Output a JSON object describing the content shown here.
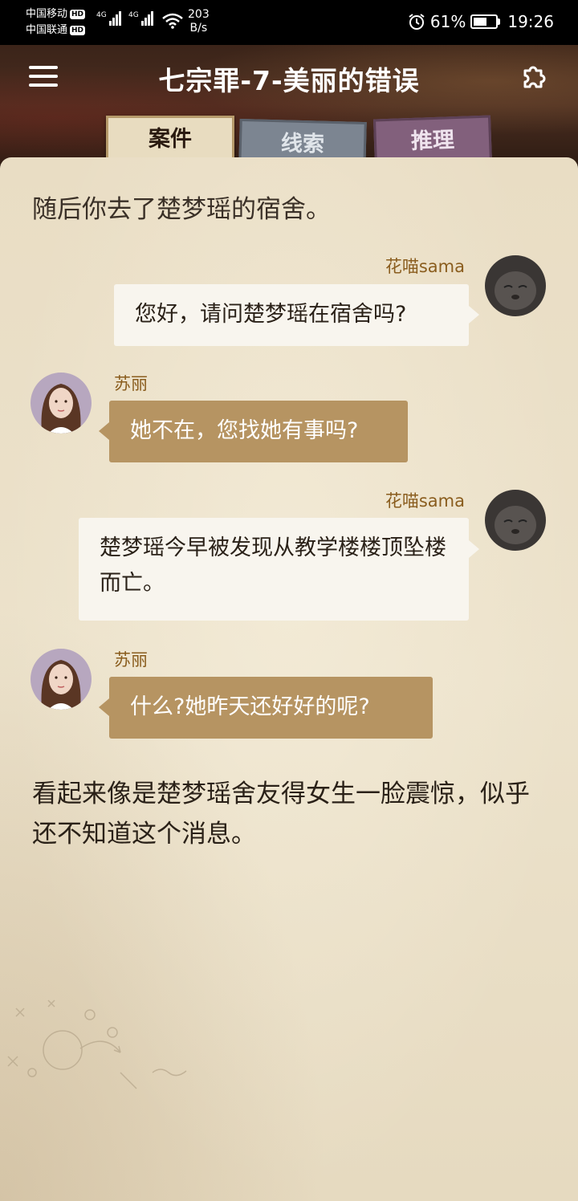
{
  "status_bar": {
    "carrier1": "中国移动",
    "carrier2": "中国联通",
    "hd": "HD",
    "net1": "4G",
    "net2": "4G",
    "speed_value": "203",
    "speed_unit": "B/s",
    "battery": "61%",
    "battery_level": 0.61,
    "time": "19:26",
    "icons": [
      "alarm-icon",
      "battery-icon",
      "wifi-icon",
      "signal-icon"
    ]
  },
  "header": {
    "title": "七宗罪-7-美丽的错误",
    "tabs": [
      {
        "label": "案件",
        "active": true
      },
      {
        "label": "线索",
        "active": false
      },
      {
        "label": "推理",
        "active": false
      }
    ],
    "icons": [
      "menu-icon",
      "puzzle-icon"
    ]
  },
  "story": {
    "narration_top": "随后你去了楚梦瑶的宿舍。",
    "messages": [
      {
        "sender": "花喵sama",
        "text": "您好，请问楚梦瑶在宿舍吗?",
        "side": "right"
      },
      {
        "sender": "苏丽",
        "text": "她不在，您找她有事吗?",
        "side": "left"
      },
      {
        "sender": "花喵sama",
        "text": "楚梦瑶今早被发现从教学楼楼顶坠楼而亡。",
        "side": "right"
      },
      {
        "sender": "苏丽",
        "text": "什么?她昨天还好好的呢?",
        "side": "left"
      }
    ],
    "narration_bottom": "看起来像是楚梦瑶舍友得女生一脸震惊，似乎还不知道这个消息。"
  },
  "colors": {
    "header_bg": "#3b2419",
    "paper": "#ece2cb",
    "bubble_me": "#f8f5ee",
    "bubble_other": "#b69462",
    "sender_name": "#8a5d1e"
  }
}
